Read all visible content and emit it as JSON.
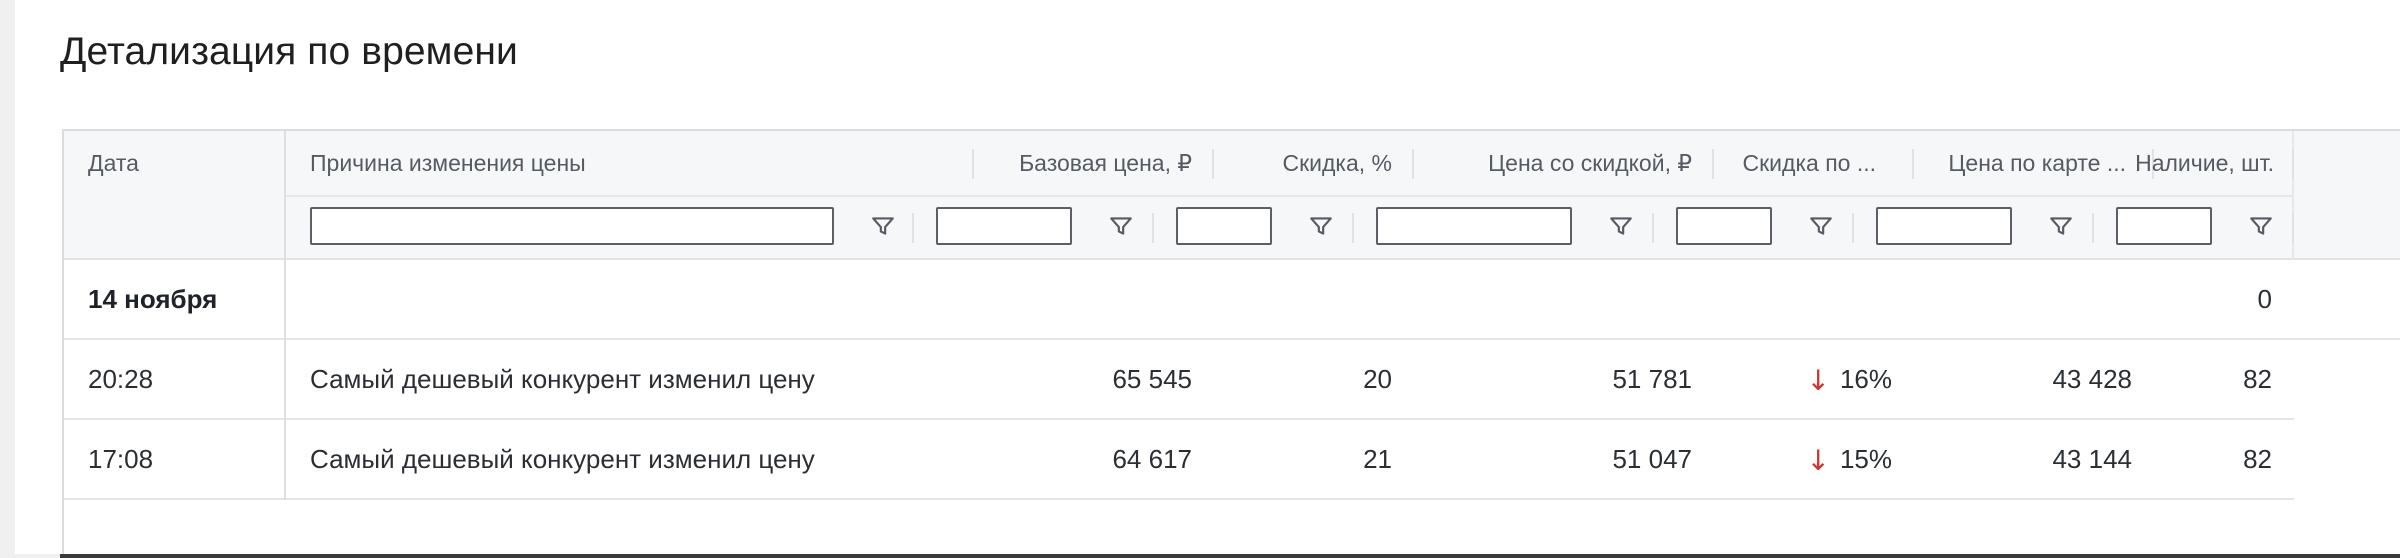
{
  "page": {
    "title": "Детализация по времени"
  },
  "table": {
    "columns": [
      {
        "key": "date",
        "label": "Дата"
      },
      {
        "key": "reason",
        "label": "Причина изменения цены"
      },
      {
        "key": "base_price",
        "label": "Базовая цена, ₽"
      },
      {
        "key": "discount",
        "label": "Скидка, %"
      },
      {
        "key": "discount_price",
        "label": "Цена со скидкой, ₽"
      },
      {
        "key": "card_discount",
        "label": "Скидка по ..."
      },
      {
        "key": "card_price",
        "label": "Цена по карте ..."
      },
      {
        "key": "stock",
        "label": "Наличие, шт."
      }
    ],
    "filters": {
      "reason": "",
      "base_price": "",
      "discount": "",
      "discount_price": "",
      "card_discount": "",
      "card_price": "",
      "stock": ""
    },
    "group": {
      "label": "14 ноября",
      "stock_total": "0"
    },
    "rows": [
      {
        "time": "20:28",
        "reason": "Самый дешевый конкурент изменил цену",
        "base_price": "65 545",
        "discount": "20",
        "discount_price": "51 781",
        "card_discount": "16%",
        "card_discount_trend": "down",
        "card_price": "43 428",
        "stock": "82"
      },
      {
        "time": "17:08",
        "reason": "Самый дешевый конкурент изменил цену",
        "base_price": "64 617",
        "discount": "21",
        "discount_price": "51 047",
        "card_discount": "15%",
        "card_discount_trend": "down",
        "card_price": "43 144",
        "stock": "82"
      }
    ]
  },
  "colors": {
    "header_bg": "#f6f7f9",
    "border": "#d9dce1",
    "trend_down": "#d6312b"
  },
  "icons": {
    "filter": "filter-icon",
    "trend_down": "arrow-down-icon"
  }
}
